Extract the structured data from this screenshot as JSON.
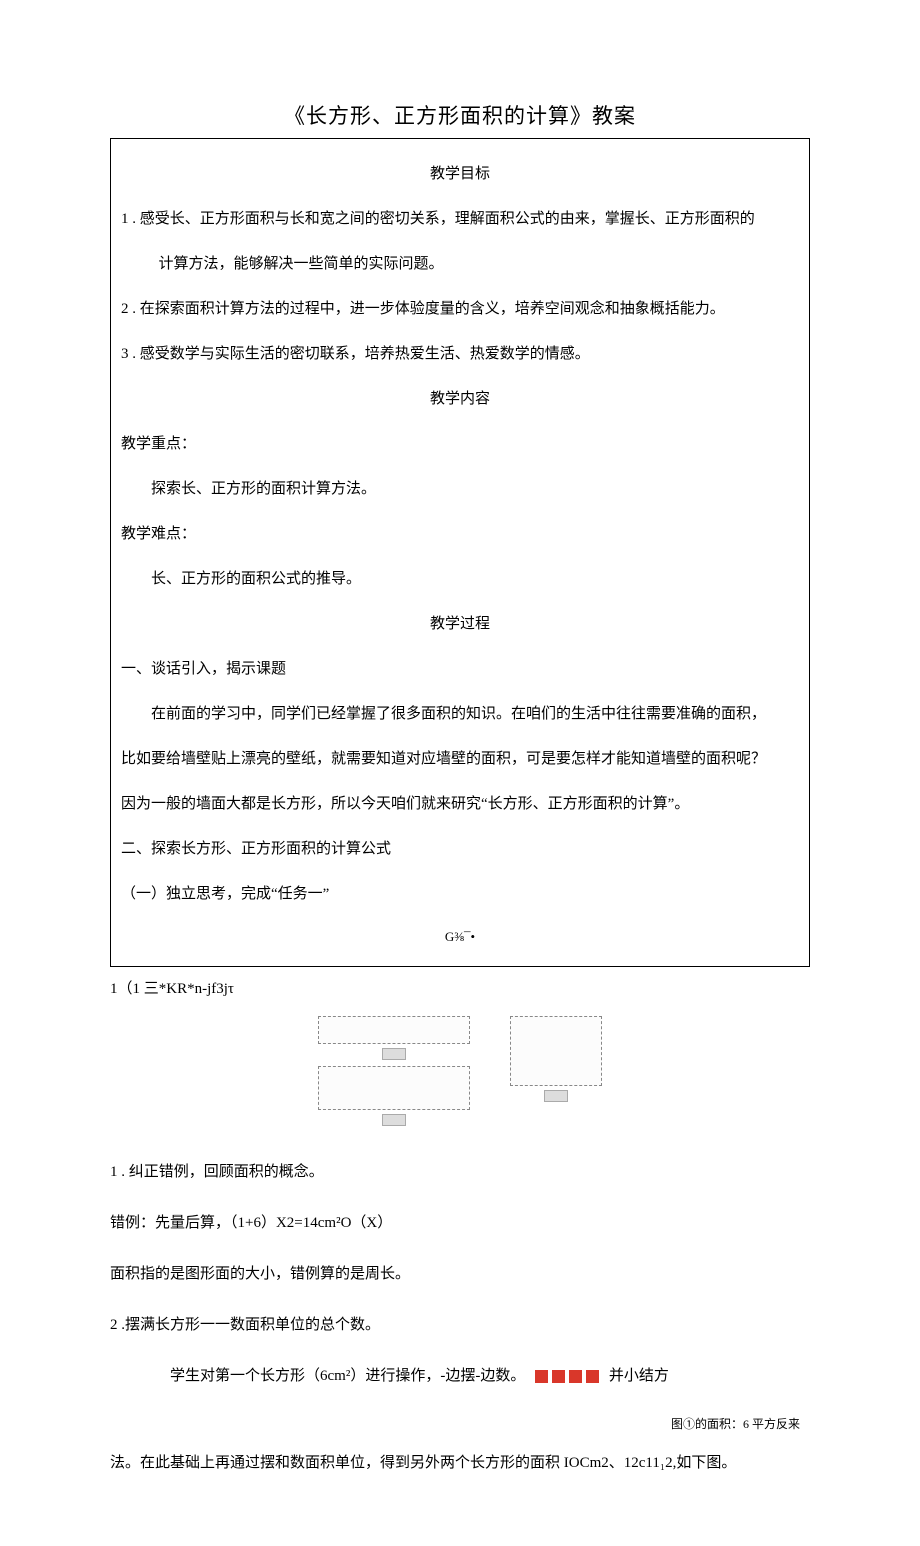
{
  "title": "《长方形、正方形面积的计算》教案",
  "sections": {
    "goals_heading": "教学目标",
    "goal1": "1 . 感受长、正方形面积与长和宽之间的密切关系，理解面积公式的由来，掌握长、正方形面积的",
    "goal1b": "计算方法，能够解决一些简单的实际问题。",
    "goal2": "2  . 在探索面积计算方法的过程中，进一步体验度量的含义，培养空间观念和抽象概括能力。",
    "goal3": "3  . 感受数学与实际生活的密切联系，培养热爱生活、热爱数学的情感。",
    "content_heading": "教学内容",
    "focus_label": "教学重点：",
    "focus_text": "探索长、正方形的面积计算方法。",
    "difficulty_label": "教学难点：",
    "difficulty_text": "长、正方形的面积公式的推导。",
    "process_heading": "教学过程",
    "proc1": "一、谈话引入，揭示课题",
    "proc1_p1": "在前面的学习中，同学们已经掌握了很多面积的知识。在咱们的生活中往往需要准确的面积，",
    "proc1_p2": "比如要给墙壁贴上漂亮的壁纸，就需要知道对应墙壁的面积，可是要怎样才能知道墙壁的面积呢？",
    "proc1_p3": "因为一般的墙面大都是长方形，所以今天咱们就来研究“长方形、正方形面积的计算”。",
    "proc2": "二、探索长方形、正方形面积的计算公式",
    "proc2_sub1": "（一）独立思考，完成“任务一”",
    "garble": "G⅜¯•"
  },
  "below": {
    "garble_line": "1（1 三*KR*n-jf3jτ",
    "item1": "1  . 纠正错例，回顾面积的概念。",
    "item1_ex": "错例：先量后算，（1+6）X2=14cm²O（X）",
    "item1_note": "面积指的是图形面的大小，错例算的是周长。",
    "item2": "2  .摆满长方形一一数面积单位的总个数。",
    "item2_p1a": "学生对第一个长方形（6cm²）进行操作，-边摆-边数。",
    "item2_p1b": "并小结方",
    "caption": "图①的面积：6 平方反来",
    "item2_p2": "法。在此基础上再通过摆和数面积单位，得到另外两个长方形的面积 IOCm2、12c11₁2,如下图。"
  }
}
